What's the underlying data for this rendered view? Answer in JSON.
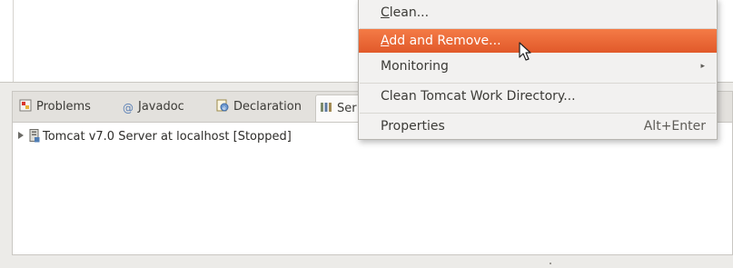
{
  "context_menu": {
    "items": [
      {
        "label": "Clean...",
        "mnemonic": "C",
        "rest": "lean..."
      },
      {
        "label": "Add and Remove...",
        "mnemonic": "A",
        "rest": "dd and Remove...",
        "highlighted": true
      },
      {
        "label": "Monitoring",
        "has_submenu": true
      },
      {
        "label": "Clean Tomcat Work Directory..."
      },
      {
        "label": "Properties",
        "accelerator": "Alt+Enter"
      }
    ],
    "highlight_color": "#e9622f"
  },
  "panel": {
    "tabs": [
      {
        "label": "Problems",
        "icon": "problems-icon"
      },
      {
        "label": "Javadoc",
        "icon": "at-sign-icon"
      },
      {
        "label": "Declaration",
        "icon": "declaration-icon"
      },
      {
        "label": "Ser",
        "icon": "servers-icon",
        "active": true
      }
    ],
    "servers": [
      {
        "label": "Tomcat v7.0 Server at localhost  [Stopped]",
        "icon": "server-icon"
      }
    ]
  },
  "submenu_arrow": "▸"
}
